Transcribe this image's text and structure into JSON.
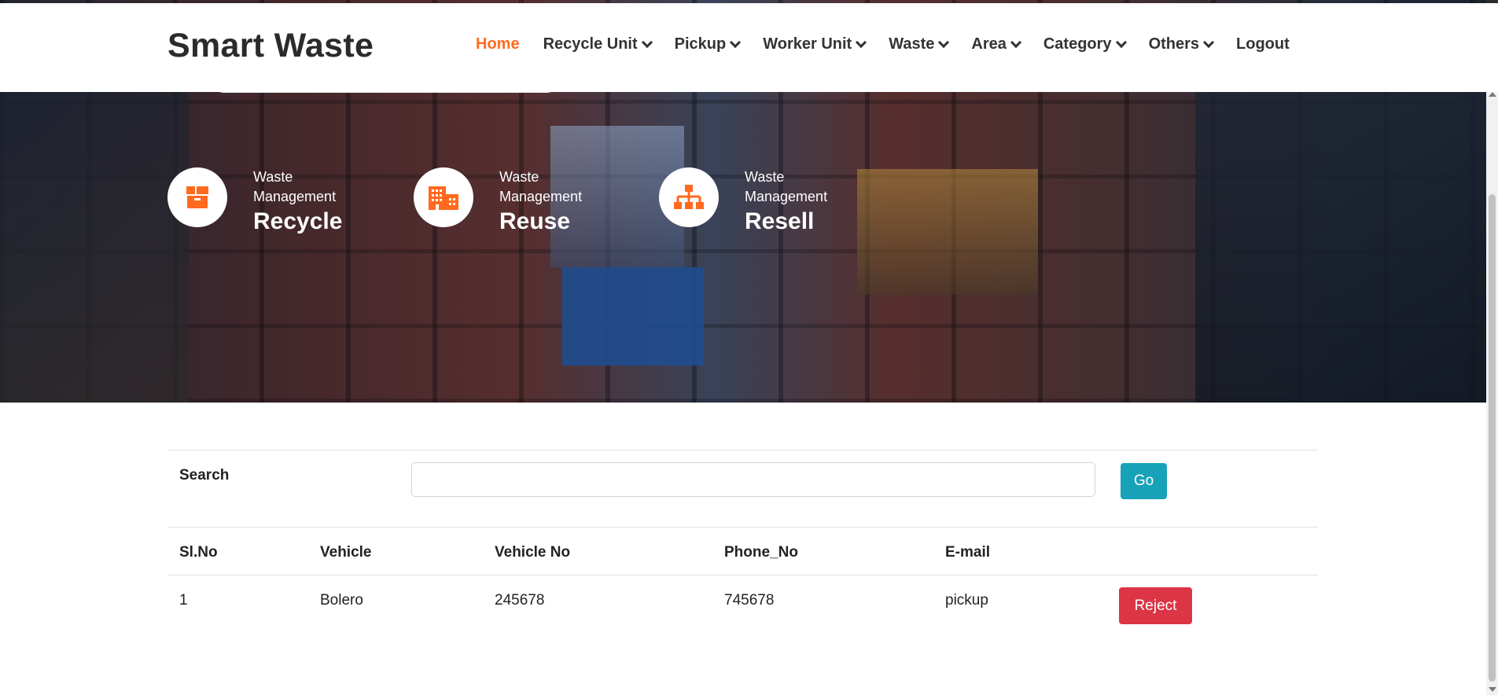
{
  "brand": "Smart Waste",
  "nav": [
    {
      "label": "Home",
      "active": true,
      "dropdown": false
    },
    {
      "label": "Recycle Unit",
      "active": false,
      "dropdown": true
    },
    {
      "label": "Pickup",
      "active": false,
      "dropdown": true
    },
    {
      "label": "Worker Unit",
      "active": false,
      "dropdown": true
    },
    {
      "label": "Waste",
      "active": false,
      "dropdown": true
    },
    {
      "label": "Area",
      "active": false,
      "dropdown": true
    },
    {
      "label": "Category",
      "active": false,
      "dropdown": true
    },
    {
      "label": "Others",
      "active": false,
      "dropdown": true
    },
    {
      "label": "Logout",
      "active": false,
      "dropdown": false
    }
  ],
  "features": [
    {
      "small": "Waste Management",
      "big": "Recycle",
      "icon": "box-icon"
    },
    {
      "small": "Waste Management",
      "big": "Reuse",
      "icon": "building-icon"
    },
    {
      "small": "Waste Management",
      "big": "Resell",
      "icon": "sitemap-icon"
    }
  ],
  "search": {
    "label": "Search",
    "value": "",
    "button": "Go"
  },
  "table": {
    "headers": [
      "Sl.No",
      "Vehicle",
      "Vehicle No",
      "Phone_No",
      "E-mail"
    ],
    "rows": [
      {
        "slno": "1",
        "vehicle": "Bolero",
        "vehicle_no": "245678",
        "phone": "745678",
        "email": "pickup",
        "action": "Reject"
      }
    ]
  },
  "colors": {
    "accent": "#ff6a1f",
    "go": "#17a2b8",
    "reject": "#dc3545"
  }
}
